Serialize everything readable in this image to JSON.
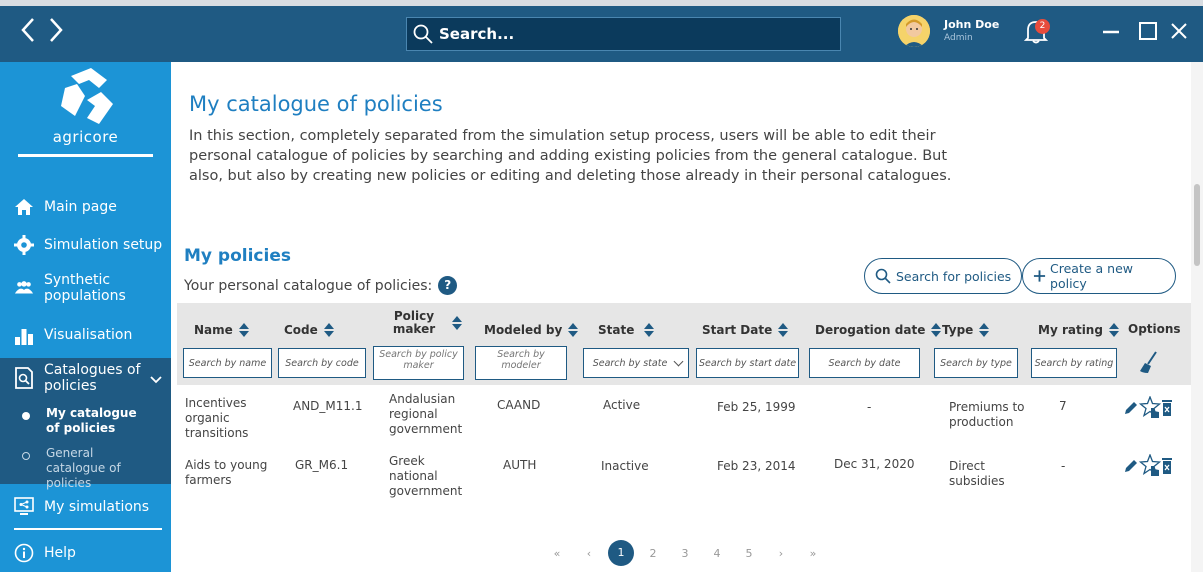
{
  "topbar": {
    "search_placeholder": "Search...",
    "user_name": "John Doe",
    "user_role": "Admin",
    "notifications_count": "2"
  },
  "sidebar": {
    "logo_text": "agricore",
    "items": [
      {
        "label": "Main page",
        "icon": "home-icon"
      },
      {
        "label": "Simulation setup",
        "icon": "gear-icon"
      },
      {
        "label": "Synthetic populations",
        "icon": "people-icon"
      },
      {
        "label": "Visualisation",
        "icon": "bar-chart-icon"
      },
      {
        "label": "Catalogues of policies",
        "icon": "catalogue-icon"
      },
      {
        "label": "My simulations",
        "icon": "monitor-icon"
      },
      {
        "label": "Help",
        "icon": "info-icon"
      }
    ],
    "subitems": [
      {
        "label": "My catalogue of policies"
      },
      {
        "label": "General catalogue of policies"
      }
    ]
  },
  "main": {
    "title": "My catalogue of policies",
    "intro": "In this section, completely separated from the simulation setup process, users will be able to edit their personal catalogue of policies by searching and adding existing policies from the general catalogue. But also, but also by creating new policies or editing and deleting those already in their personal catalogues.",
    "section_title": "My policies",
    "section_subtitle": "Your personal catalogue of policies:",
    "search_policies_label": "Search for policies",
    "create_policy_label": "Create a new policy"
  },
  "table": {
    "headers": {
      "name": "Name",
      "code": "Code",
      "policy_maker": "Policy maker",
      "modeled_by": "Modeled by",
      "state": "State",
      "start_date": "Start Date",
      "derogation_date": "Derogation date",
      "type": "Type",
      "my_rating": "My rating",
      "options": "Options"
    },
    "filters": {
      "name": "Search by name",
      "code": "Search by code",
      "policy_maker": "Search by policy maker",
      "modeled_by": "Search by modeler",
      "state": "Search by state",
      "start_date": "Search by start date",
      "derogation_date": "Search by date",
      "type": "Search by type",
      "my_rating": "Search by rating"
    },
    "rows": [
      {
        "name": "Incentives organic transitions",
        "code": "AND_M11.1",
        "policy_maker": "Andalusian regional government",
        "modeled_by": "CAAND",
        "state": "Active",
        "start_date": "Feb 25, 1999",
        "derogation_date": "-",
        "type": "Premiums to production",
        "my_rating": "7"
      },
      {
        "name": "Aids to young farmers",
        "code": "GR_M6.1",
        "policy_maker": "Greek national government",
        "modeled_by": "AUTH",
        "state": "Inactive",
        "start_date": "Feb 23, 2014",
        "derogation_date": "Dec 31, 2020",
        "type": "Direct subsidies",
        "my_rating": "-"
      }
    ]
  },
  "pagination": {
    "first": "«",
    "prev": "‹",
    "pages": [
      "1",
      "2",
      "3",
      "4",
      "5"
    ],
    "current": "1",
    "next": "›",
    "last": "»"
  },
  "colors": {
    "topbar": "#1f5a83",
    "sidebar": "#1c94d6",
    "accent": "#1f7fc1",
    "table_header": "#e6e6e6"
  }
}
